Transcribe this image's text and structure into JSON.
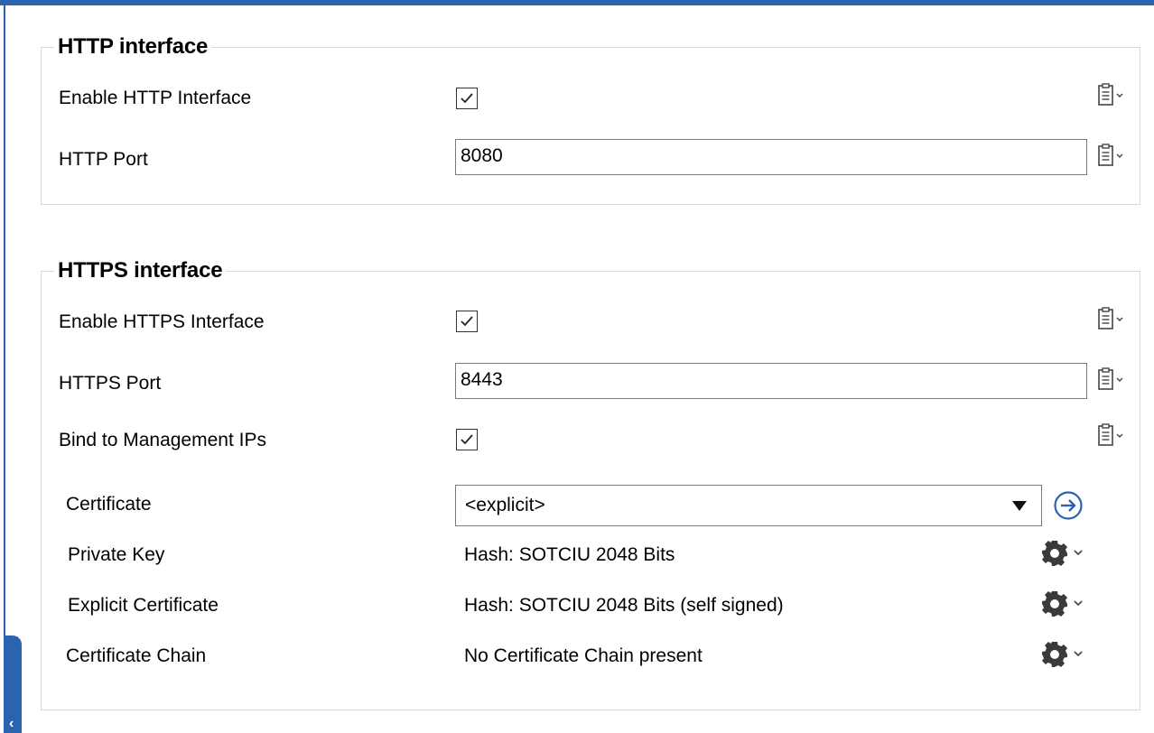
{
  "http": {
    "title": "HTTP interface",
    "enable_label": "Enable HTTP Interface",
    "enable_checked": true,
    "port_label": "HTTP Port",
    "port_value": "8080"
  },
  "https": {
    "title": "HTTPS interface",
    "enable_label": "Enable HTTPS Interface",
    "enable_checked": true,
    "port_label": "HTTPS Port",
    "port_value": "8443",
    "bind_label": "Bind to Management IPs",
    "bind_checked": true,
    "certificate_label": "Certificate",
    "certificate_value": "<explicit>",
    "private_key_label": "Private Key",
    "private_key_value": "Hash: SOTCIU 2048 Bits",
    "explicit_cert_label": "Explicit Certificate",
    "explicit_cert_value": "Hash: SOTCIU 2048 Bits (self signed)",
    "chain_label": "Certificate Chain",
    "chain_value": "No Certificate Chain present"
  },
  "icons": {
    "clipboard": "clipboard-icon",
    "gear": "gear-icon",
    "go": "arrow-right-circle-icon",
    "collapse": "chevron-left-icon"
  },
  "colors": {
    "accent": "#2b63b0",
    "border": "#d9d9d9"
  }
}
